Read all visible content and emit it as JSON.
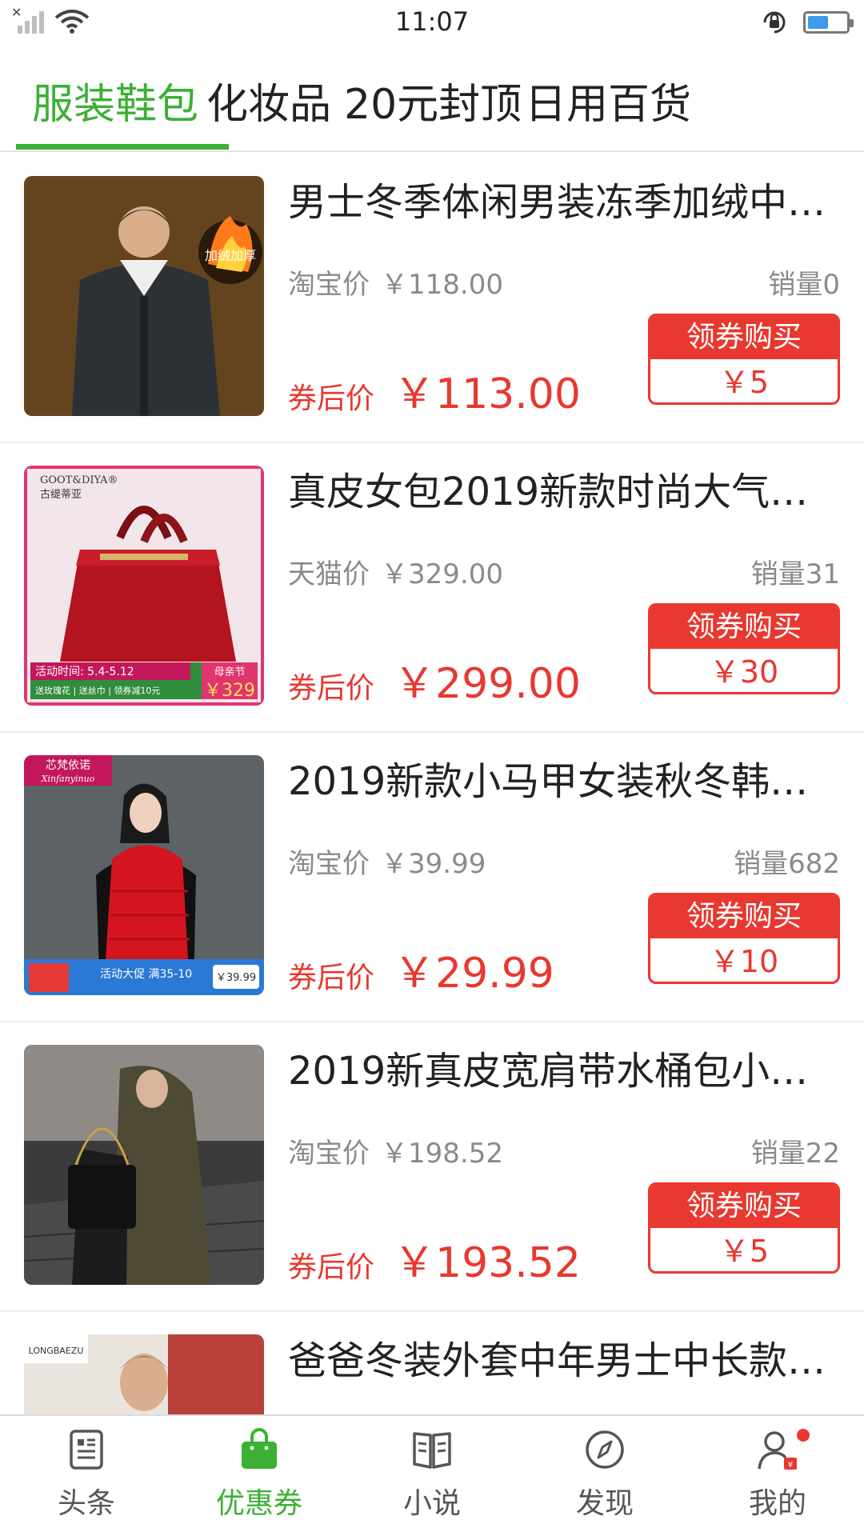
{
  "status_bar": {
    "time": "11:07",
    "battery_level": 0.55,
    "colors": {
      "battery": "#3d9be9"
    }
  },
  "tabs": [
    {
      "label": "服装鞋包",
      "active": true
    },
    {
      "label": "化妆品",
      "active": false
    },
    {
      "label": "20元封顶",
      "active": false
    },
    {
      "label": "日用百货",
      "active": false
    }
  ],
  "accent_color": "#3cb034",
  "price_color": "#e8382f",
  "products": [
    {
      "title": "男士冬季体闲男装冻季加绒中…",
      "orig_label": "淘宝价",
      "orig_price": "￥118.00",
      "sales": "销量0",
      "after_label": "券后价",
      "after_price": "￥113.00",
      "coupon_label": "领券购买",
      "coupon_amount": "￥5",
      "image_icon": "men-winter-jacket-photo",
      "image_text": "加绒加厚"
    },
    {
      "title": "真皮女包2019新款时尚大气中…",
      "orig_label": "天猫价",
      "orig_price": "￥329.00",
      "sales": "销量31",
      "after_label": "券后价",
      "after_price": "￥299.00",
      "coupon_label": "领券购买",
      "coupon_amount": "￥30",
      "image_icon": "red-handbag-photo",
      "image_brand": "GOOT&DIYA®",
      "image_brand_cn": "古缇蒂亚",
      "image_promo_date": "活动时间: 5.4-5.12",
      "image_promo_sub": "送玫瑰花 | 送丝巾 | 领券减10元",
      "image_promo_tag": "母亲节",
      "image_promo_price": "￥329"
    },
    {
      "title": "2019新款小马甲女装秋冬韩版…",
      "orig_label": "淘宝价",
      "orig_price": "￥39.99",
      "sales": "销量682",
      "after_label": "券后价",
      "after_price": "￥29.99",
      "coupon_label": "领券购买",
      "coupon_amount": "￥10",
      "image_icon": "red-vest-woman-photo",
      "image_brand": "芯梵依诺",
      "image_brand_en": "Xinfanyinuo",
      "image_promo": "活动大促 满35-10",
      "image_promo_price": "￥39.99"
    },
    {
      "title": "2019新真皮宽肩带水桶包小香…",
      "orig_label": "淘宝价",
      "orig_price": "￥198.52",
      "sales": "销量22",
      "after_label": "券后价",
      "after_price": "￥193.52",
      "coupon_label": "领券购买",
      "coupon_amount": "￥5",
      "image_icon": "black-bucket-bag-photo"
    },
    {
      "title": "爸爸冬装外套中年男士中长款…",
      "image_icon": "men-coat-photo",
      "image_brand": "LONGBAEZU"
    }
  ],
  "bottom_nav": [
    {
      "label": "头条",
      "icon": "news-icon",
      "active": false
    },
    {
      "label": "优惠券",
      "icon": "shopping-bag-icon",
      "active": true
    },
    {
      "label": "小说",
      "icon": "book-icon",
      "active": false
    },
    {
      "label": "发现",
      "icon": "compass-icon",
      "active": false
    },
    {
      "label": "我的",
      "icon": "user-icon",
      "active": false,
      "badge": true
    }
  ]
}
